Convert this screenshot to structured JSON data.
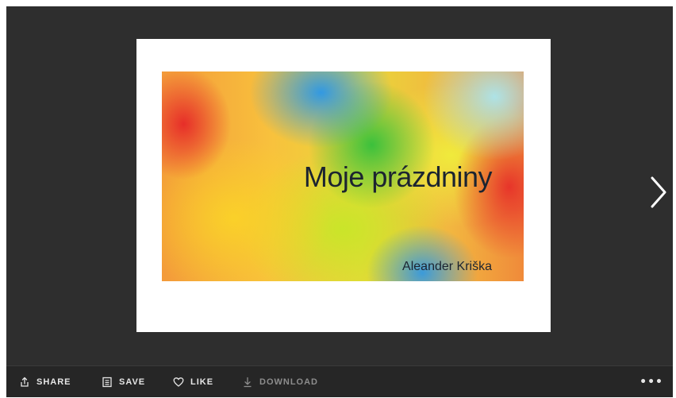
{
  "slide": {
    "title": "Moje prázdniny",
    "author": "Aleander Kriška"
  },
  "navigation": {
    "next_icon": "chevron-right-icon"
  },
  "toolbar": {
    "share_label": "SHARE",
    "share_icon": "share-icon",
    "save_label": "SAVE",
    "save_icon": "save-icon",
    "like_label": "LIKE",
    "like_icon": "heart-icon",
    "download_label": "DOWNLOAD",
    "download_icon": "download-icon",
    "download_enabled": false,
    "more_label": "•••",
    "more_icon": "more-icon"
  },
  "colors": {
    "viewer_background": "#2e2e2e",
    "toolbar_background": "#262626",
    "toolbar_text": "#e6e6e6",
    "toolbar_disabled_text": "#8d8d8d"
  }
}
